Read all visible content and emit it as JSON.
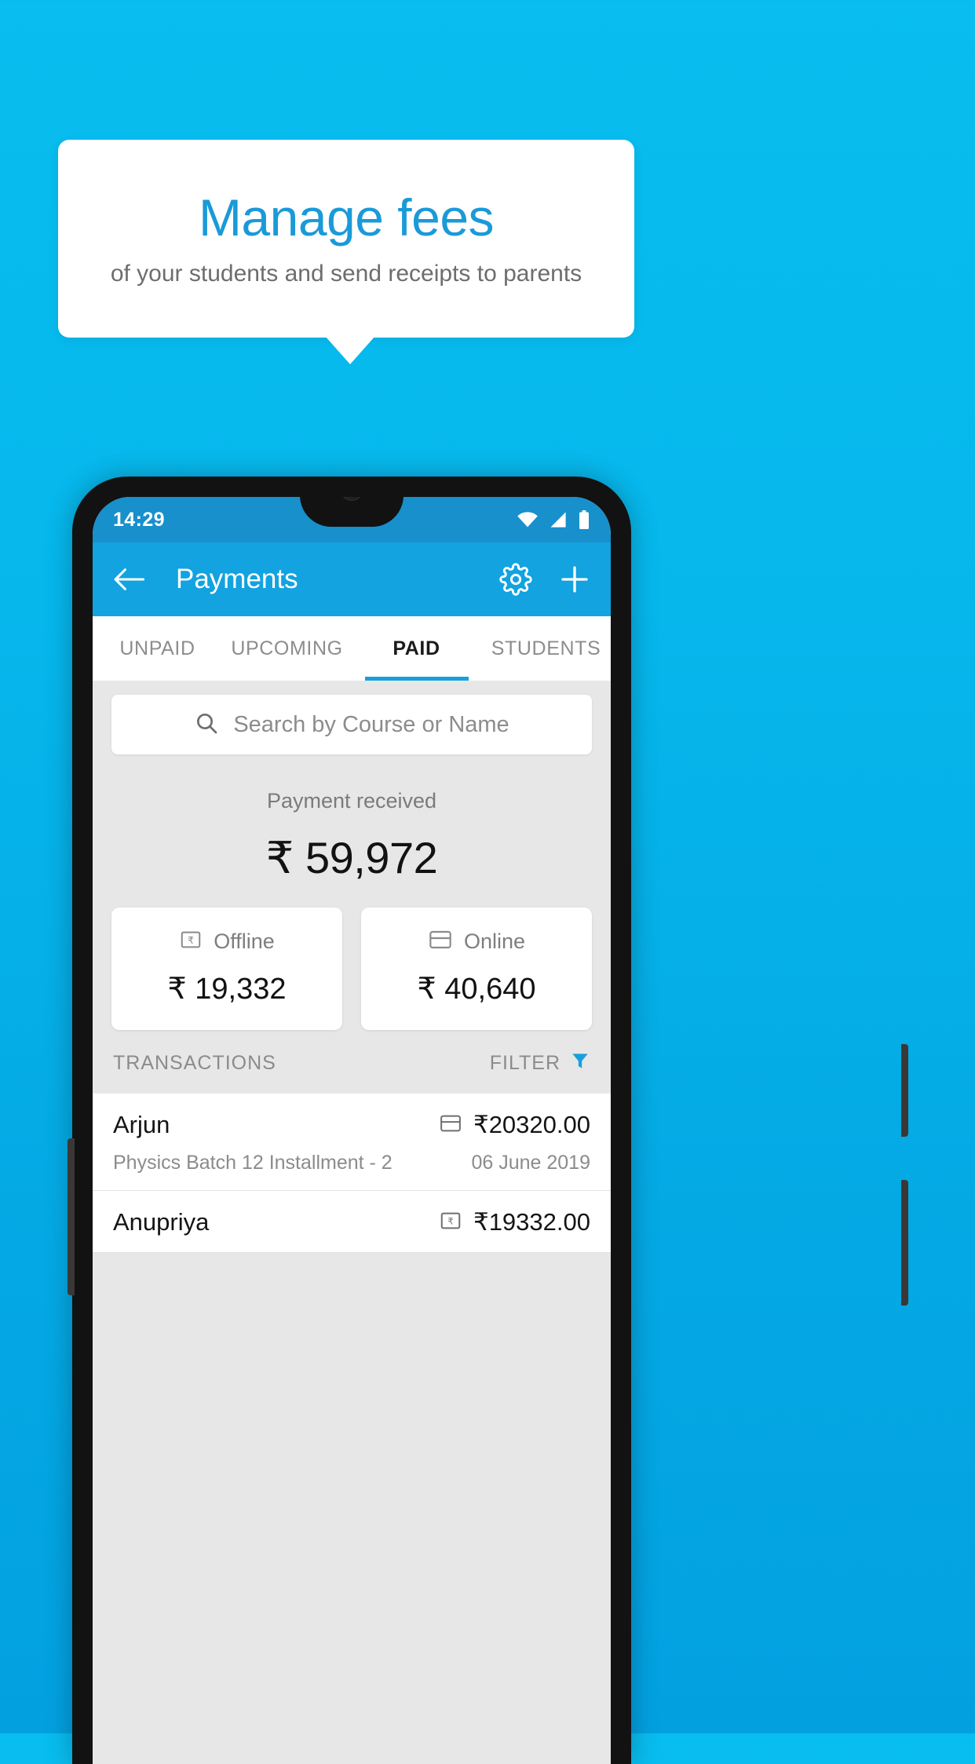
{
  "promo": {
    "title": "Manage fees",
    "subtitle": "of your students and send receipts to parents",
    "title_color": "#1a9ad8",
    "background_color": "#07bbee"
  },
  "statusbar": {
    "time": "14:29",
    "icons": [
      "wifi-icon",
      "signal-icon",
      "battery-icon"
    ]
  },
  "appbar": {
    "title": "Payments",
    "back_icon": "back-arrow-icon",
    "settings_icon": "gear-icon",
    "add_icon": "plus-icon",
    "background_color": "#12a3e0"
  },
  "tabs": [
    {
      "label": "UNPAID",
      "active": false
    },
    {
      "label": "UPCOMING",
      "active": false
    },
    {
      "label": "PAID",
      "active": true
    },
    {
      "label": "STUDENTS",
      "active": false
    }
  ],
  "search": {
    "placeholder": "Search by Course or Name",
    "value": "",
    "icon": "search-icon"
  },
  "summary": {
    "label": "Payment received",
    "amount": "₹ 59,972"
  },
  "breakdown": [
    {
      "label": "Offline",
      "amount": "₹ 19,332",
      "icon": "cash-note-icon"
    },
    {
      "label": "Online",
      "amount": "₹ 40,640",
      "icon": "credit-card-icon"
    }
  ],
  "list_header": {
    "title": "TRANSACTIONS",
    "filter_label": "FILTER",
    "filter_icon": "funnel-icon",
    "filter_color": "#18a0dc"
  },
  "transactions": [
    {
      "name": "Arjun",
      "amount": "₹20320.00",
      "method_icon": "credit-card-icon",
      "course": "Physics Batch 12 Installment - 2",
      "date": "06 June 2019"
    },
    {
      "name": "Anupriya",
      "amount": "₹19332.00",
      "method_icon": "cash-note-icon",
      "course": "",
      "date": ""
    }
  ]
}
